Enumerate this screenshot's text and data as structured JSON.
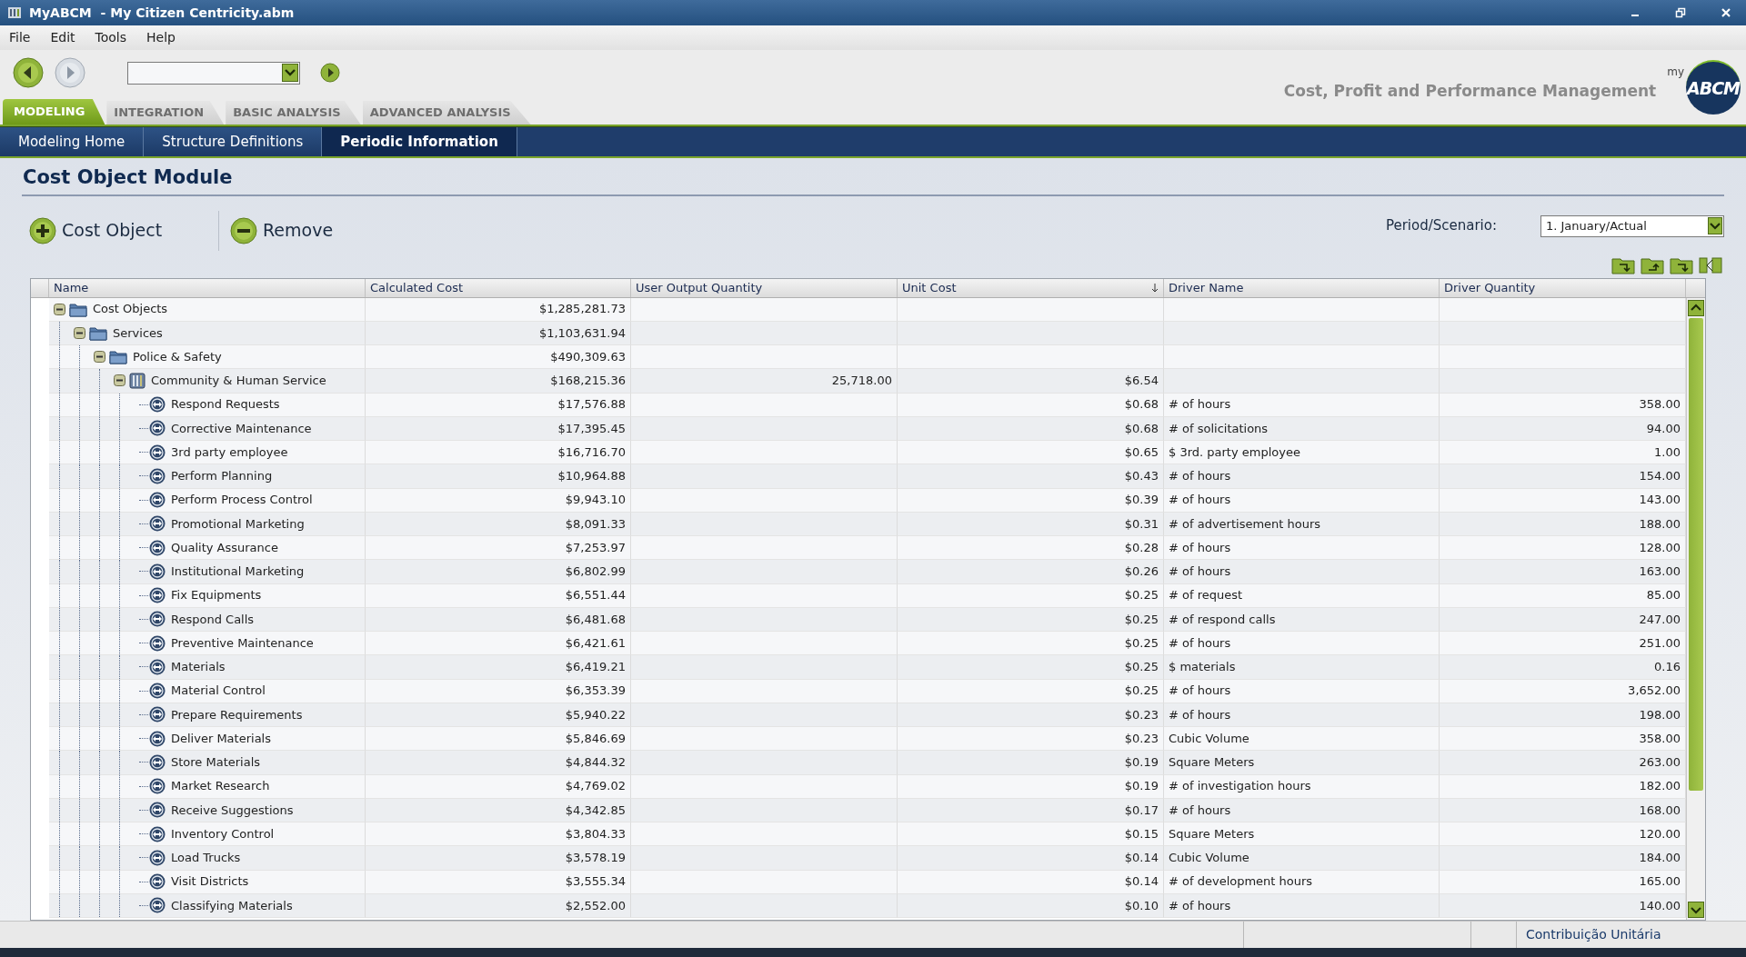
{
  "window": {
    "title": "MyABCM  - My Citizen Centricity.abm"
  },
  "menu": [
    "File",
    "Edit",
    "Tools",
    "Help"
  ],
  "toolbar": {
    "tagline": "Cost, Profit and Performance Management",
    "logo_small": "my",
    "logo": "ABCM"
  },
  "tabs": [
    {
      "label": "MODELING",
      "selected": true
    },
    {
      "label": "INTEGRATION",
      "selected": false
    },
    {
      "label": "BASIC ANALYSIS",
      "selected": false
    },
    {
      "label": "ADVANCED ANALYSIS",
      "selected": false
    }
  ],
  "subnav": [
    {
      "label": "Modeling Home",
      "selected": false
    },
    {
      "label": "Structure Definitions",
      "selected": false
    },
    {
      "label": "Periodic Information",
      "selected": true
    }
  ],
  "module": {
    "title": "Cost Object Module",
    "actions": [
      {
        "label": "Cost Object",
        "kind": "add"
      },
      {
        "label": "Remove",
        "kind": "remove"
      }
    ],
    "period_label": "Period/Scenario:",
    "period_value": "1. January/Actual"
  },
  "table": {
    "columns": [
      "Name",
      "Calculated Cost",
      "User Output Quantity",
      "Unit Cost",
      "Driver Name",
      "Driver Quantity"
    ],
    "rows": [
      {
        "name": "Cost Objects",
        "kind": "folder",
        "expanded": true,
        "cost": "$1,285,281.73",
        "children": [
          {
            "name": "Services",
            "kind": "folder",
            "expanded": true,
            "cost": "$1,103,631.94",
            "children": [
              {
                "name": "Police & Safety",
                "kind": "folder",
                "expanded": true,
                "cost": "$490,309.63",
                "children": [
                  {
                    "name": "Community & Human Service",
                    "kind": "center",
                    "expanded": true,
                    "cost": "$168,215.36",
                    "output": "25,718.00",
                    "unit": "$6.54",
                    "children": [
                      {
                        "name": "Respond Requests",
                        "kind": "activity",
                        "cost": "$17,576.88",
                        "unit": "$0.68",
                        "driver": "# of hours",
                        "qty": "358.00"
                      },
                      {
                        "name": "Corrective Maintenance",
                        "kind": "activity",
                        "cost": "$17,395.45",
                        "unit": "$0.68",
                        "driver": "# of solicitations",
                        "qty": "94.00"
                      },
                      {
                        "name": "3rd party employee",
                        "kind": "activity",
                        "cost": "$16,716.70",
                        "unit": "$0.65",
                        "driver": "$ 3rd. party employee",
                        "qty": "1.00"
                      },
                      {
                        "name": "Perform Planning",
                        "kind": "activity",
                        "cost": "$10,964.88",
                        "unit": "$0.43",
                        "driver": "# of hours",
                        "qty": "154.00"
                      },
                      {
                        "name": "Perform Process Control",
                        "kind": "activity",
                        "cost": "$9,943.10",
                        "unit": "$0.39",
                        "driver": "# of hours",
                        "qty": "143.00"
                      },
                      {
                        "name": "Promotional Marketing",
                        "kind": "activity",
                        "cost": "$8,091.33",
                        "unit": "$0.31",
                        "driver": "# of advertisement hours",
                        "qty": "188.00"
                      },
                      {
                        "name": "Quality Assurance",
                        "kind": "activity",
                        "cost": "$7,253.97",
                        "unit": "$0.28",
                        "driver": "# of hours",
                        "qty": "128.00"
                      },
                      {
                        "name": "Institutional Marketing",
                        "kind": "activity",
                        "cost": "$6,802.99",
                        "unit": "$0.26",
                        "driver": "# of hours",
                        "qty": "163.00"
                      },
                      {
                        "name": "Fix Equipments",
                        "kind": "activity",
                        "cost": "$6,551.44",
                        "unit": "$0.25",
                        "driver": "# of request",
                        "qty": "85.00"
                      },
                      {
                        "name": "Respond Calls",
                        "kind": "activity",
                        "cost": "$6,481.68",
                        "unit": "$0.25",
                        "driver": "# of respond calls",
                        "qty": "247.00"
                      },
                      {
                        "name": "Preventive Maintenance",
                        "kind": "activity",
                        "cost": "$6,421.61",
                        "unit": "$0.25",
                        "driver": "# of hours",
                        "qty": "251.00"
                      },
                      {
                        "name": "Materials",
                        "kind": "activity",
                        "cost": "$6,419.21",
                        "unit": "$0.25",
                        "driver": "$ materials",
                        "qty": "0.16"
                      },
                      {
                        "name": "Material Control",
                        "kind": "activity",
                        "cost": "$6,353.39",
                        "unit": "$0.25",
                        "driver": "# of hours",
                        "qty": "3,652.00"
                      },
                      {
                        "name": "Prepare Requirements",
                        "kind": "activity",
                        "cost": "$5,940.22",
                        "unit": "$0.23",
                        "driver": "# of hours",
                        "qty": "198.00"
                      },
                      {
                        "name": "Deliver Materials",
                        "kind": "activity",
                        "cost": "$5,846.69",
                        "unit": "$0.23",
                        "driver": "Cubic Volume",
                        "qty": "358.00"
                      },
                      {
                        "name": "Store Materials",
                        "kind": "activity",
                        "cost": "$4,844.32",
                        "unit": "$0.19",
                        "driver": "Square Meters",
                        "qty": "263.00"
                      },
                      {
                        "name": "Market Research",
                        "kind": "activity",
                        "cost": "$4,769.02",
                        "unit": "$0.19",
                        "driver": "# of investigation hours",
                        "qty": "182.00"
                      },
                      {
                        "name": "Receive Suggestions",
                        "kind": "activity",
                        "cost": "$4,342.85",
                        "unit": "$0.17",
                        "driver": "# of hours",
                        "qty": "168.00"
                      },
                      {
                        "name": "Inventory Control",
                        "kind": "activity",
                        "cost": "$3,804.33",
                        "unit": "$0.15",
                        "driver": "Square Meters",
                        "qty": "120.00"
                      },
                      {
                        "name": "Load Trucks",
                        "kind": "activity",
                        "cost": "$3,578.19",
                        "unit": "$0.14",
                        "driver": "Cubic Volume",
                        "qty": "184.00"
                      },
                      {
                        "name": "Visit Districts",
                        "kind": "activity",
                        "cost": "$3,555.34",
                        "unit": "$0.14",
                        "driver": "# of development hours",
                        "qty": "165.00"
                      },
                      {
                        "name": "Classifying Materials",
                        "kind": "activity",
                        "cost": "$2,552.00",
                        "unit": "$0.10",
                        "driver": "# of hours",
                        "qty": "140.00"
                      }
                    ]
                  }
                ]
              }
            ]
          }
        ]
      }
    ]
  },
  "status_bar": {
    "right": "Contribuição Unitária"
  }
}
